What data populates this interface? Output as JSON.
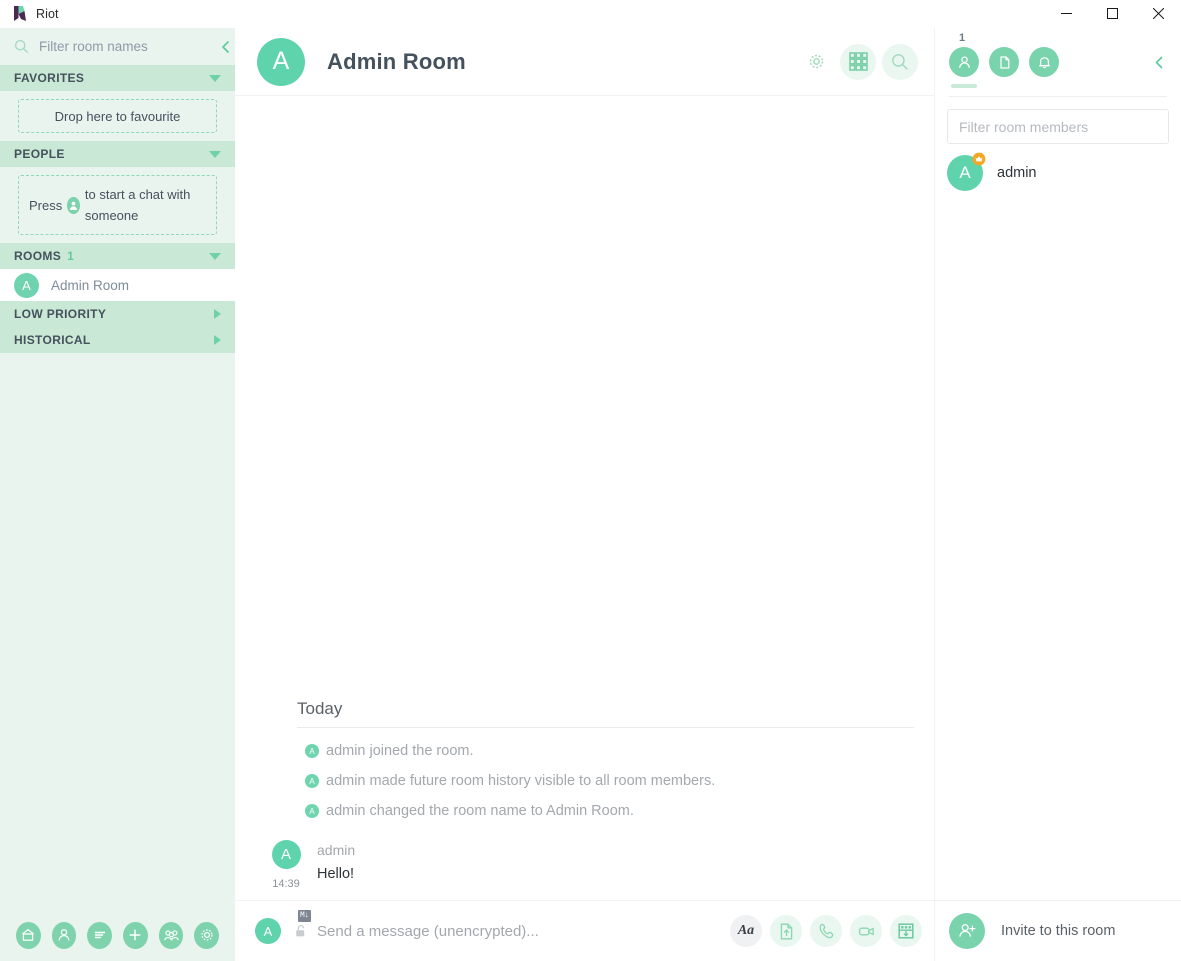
{
  "window": {
    "app_title": "Riot",
    "logo_icon": "riot-logo-icon",
    "controls": {
      "minimize": "minimize-icon",
      "maximize": "maximize-icon",
      "close": "close-icon"
    }
  },
  "sidebar": {
    "filter": {
      "placeholder": "Filter room names",
      "value": "",
      "icon": "search-icon",
      "collapse_icon": "chevron-left-icon"
    },
    "sections": [
      {
        "label": "FAVORITES",
        "count": "",
        "expanded": true,
        "toggle_icon": "chevron-down-icon",
        "empty_text": "Drop here to favourite"
      },
      {
        "label": "PEOPLE",
        "count": "",
        "expanded": true,
        "toggle_icon": "chevron-down-icon",
        "empty_text_before": "Press",
        "empty_inline_icon": "person-icon",
        "empty_text_after": "to start a chat with someone"
      },
      {
        "label": "ROOMS",
        "count": "1",
        "expanded": true,
        "toggle_icon": "chevron-down-icon"
      },
      {
        "label": "LOW PRIORITY",
        "count": "",
        "expanded": false,
        "toggle_icon": "chevron-right-icon"
      },
      {
        "label": "HISTORICAL",
        "count": "",
        "expanded": false,
        "toggle_icon": "chevron-right-icon"
      }
    ],
    "rooms": [
      {
        "name": "Admin Room",
        "avatar_letter": "A",
        "selected": true
      }
    ],
    "bottom_buttons": [
      {
        "name": "home-button",
        "icon": "home-icon"
      },
      {
        "name": "start-chat-button",
        "icon": "person-icon"
      },
      {
        "name": "room-directory-button",
        "icon": "list-icon"
      },
      {
        "name": "create-room-button",
        "icon": "plus-icon"
      },
      {
        "name": "create-community-button",
        "icon": "group-icon"
      },
      {
        "name": "settings-button",
        "icon": "gear-icon"
      }
    ]
  },
  "room_header": {
    "avatar_letter": "A",
    "title": "Admin Room",
    "actions": [
      {
        "name": "room-settings-button",
        "icon": "gear-icon"
      },
      {
        "name": "apps-button",
        "icon": "grid-icon"
      },
      {
        "name": "search-button",
        "icon": "search-icon"
      }
    ]
  },
  "timeline": {
    "date_separator": "Today",
    "events": [
      {
        "avatar_letter": "A",
        "text": "admin joined the room."
      },
      {
        "avatar_letter": "A",
        "text": "admin made future room history visible to all room members."
      },
      {
        "avatar_letter": "A",
        "text": "admin changed the room name to Admin Room."
      }
    ],
    "messages": [
      {
        "avatar_letter": "A",
        "sender": "admin",
        "timestamp": "14:39",
        "body": "Hello!"
      }
    ]
  },
  "composer": {
    "avatar_letter": "A",
    "markdown_badge": "M↓",
    "lock_icon": "unlocked-padlock-icon",
    "placeholder": "Send a message (unencrypted)...",
    "value": "",
    "buttons": [
      {
        "name": "formatting-button",
        "icon": "text-format-icon",
        "label": "Aa"
      },
      {
        "name": "upload-file-button",
        "icon": "upload-file-icon"
      },
      {
        "name": "voice-call-button",
        "icon": "phone-icon"
      },
      {
        "name": "video-call-button",
        "icon": "video-camera-icon"
      },
      {
        "name": "apps-button",
        "icon": "apps-drawer-icon"
      }
    ]
  },
  "right_panel": {
    "tabs": [
      {
        "name": "members-tab",
        "icon": "person-icon",
        "badge": "1",
        "active": true
      },
      {
        "name": "files-tab",
        "icon": "file-icon",
        "badge": "",
        "active": false
      },
      {
        "name": "notifications-tab",
        "icon": "bell-icon",
        "badge": "",
        "active": false
      }
    ],
    "collapse_icon": "chevron-left-icon",
    "filter": {
      "placeholder": "Filter room members",
      "value": ""
    },
    "members": [
      {
        "name": "admin",
        "avatar_letter": "A",
        "power_badge": "admin-crown-icon"
      }
    ],
    "invite": {
      "label": "Invite to this room",
      "icon": "person-add-icon"
    }
  },
  "colors": {
    "accent": "#5fd3ab",
    "sidebar_bg": "#eaf4ef",
    "section_header_bg": "#c9e8d5",
    "text_primary": "#2e3338",
    "text_muted": "#a3a8ad",
    "badge_gold": "#f5a623"
  }
}
